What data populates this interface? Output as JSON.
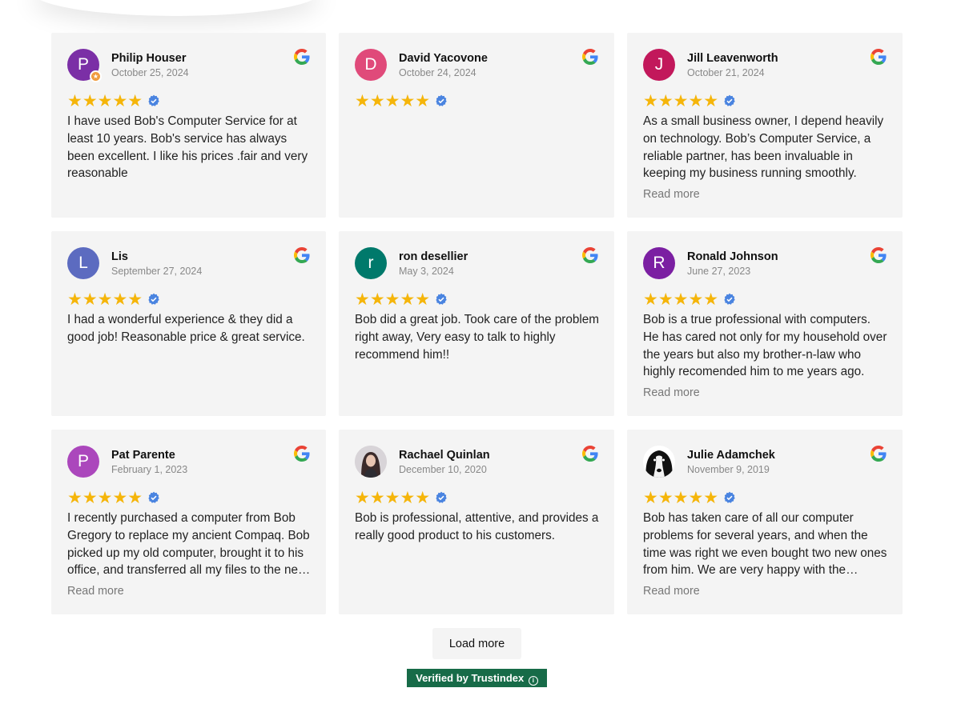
{
  "reviews": [
    {
      "name": "Philip Houser",
      "date": "October 25, 2024",
      "initial": "P",
      "avatar_color": "#7b2fa6",
      "badge": true,
      "stars": "★★★★★",
      "text": "I have used Bob's Computer Service for at least 10 years. Bob's service has always been excellent. I like his prices .fair and very reasonable",
      "read_more": ""
    },
    {
      "name": "David Yacovone",
      "date": "October 24, 2024",
      "initial": "D",
      "avatar_color": "#e04a7a",
      "badge": false,
      "stars": "★★★★★",
      "text": "",
      "read_more": ""
    },
    {
      "name": "Jill Leavenworth",
      "date": "October 21, 2024",
      "initial": "J",
      "avatar_color": "#c2185b",
      "badge": false,
      "stars": "★★★★★",
      "text": "As a small business owner, I depend heavily on technology. Bob’s Computer Service, a reliable partner, has been invaluable in keeping my business running smoothly.",
      "read_more": "Read more"
    },
    {
      "name": "Lis",
      "date": "September 27, 2024",
      "initial": "L",
      "avatar_color": "#5c6bc0",
      "badge": false,
      "stars": "★★★★★",
      "text": "I had a wonderful experience & they did a good job! Reasonable price & great service.",
      "read_more": ""
    },
    {
      "name": "ron desellier",
      "date": "May 3, 2024",
      "initial": "r",
      "avatar_color": "#00796b",
      "badge": false,
      "stars": "★★★★★",
      "text": "Bob did a great job. Took care of the problem right away, Very easy to talk to highly recommend him!!",
      "read_more": ""
    },
    {
      "name": "Ronald Johnson",
      "date": "June 27, 2023",
      "initial": "R",
      "avatar_color": "#7b1fa2",
      "badge": false,
      "stars": "★★★★★",
      "text": "Bob is a true professional with computers. He has cared not only for my household over the years but also my brother-n-law who highly recomended him to me years ago.",
      "read_more": "Read more"
    },
    {
      "name": "Pat Parente",
      "date": "February 1, 2023",
      "initial": "P",
      "avatar_color": "#ab47bc",
      "badge": false,
      "stars": "★★★★★",
      "text": "I recently purchased a computer from Bob Gregory to replace my ancient Compaq. Bob picked up my old computer, brought it to his office, and transferred all my files to the new one.",
      "read_more": "Read more"
    },
    {
      "name": "Rachael Quinlan",
      "date": "December 10, 2020",
      "initial": "",
      "avatar_color": "#8a7b7e",
      "badge": false,
      "stars": "★★★★★",
      "text": "Bob is professional, attentive, and provides a really good product to his customers.",
      "read_more": ""
    },
    {
      "name": "Julie Adamchek",
      "date": "November 9, 2019",
      "initial": "",
      "avatar_color": "#ffffff",
      "badge": false,
      "stars": "★★★★★",
      "text": "Bob has taken care of all our computer problems for several years, and when the time was right we even bought two new ones from him. We are very happy with the service.",
      "read_more": "Read more"
    }
  ],
  "load_more": "Load more",
  "verified_by": "Verified by Trustindex",
  "colors": {
    "card_bg": "#f4f4f4",
    "star": "#f5b50a",
    "verified": "#4a84e0",
    "trustindex_green": "#176b48"
  }
}
